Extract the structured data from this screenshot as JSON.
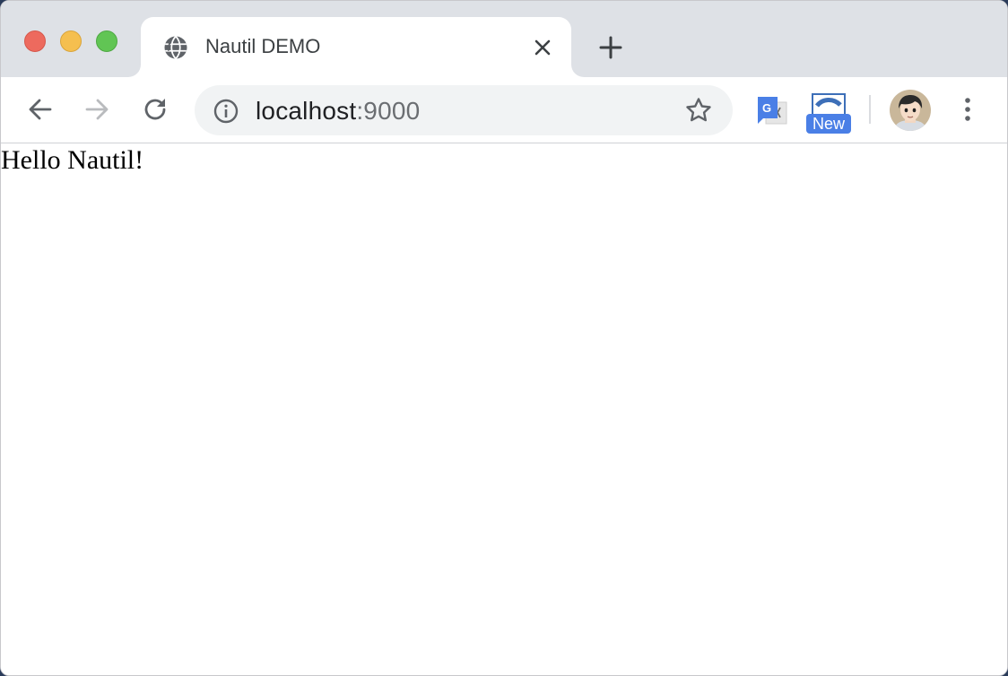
{
  "window": {
    "traffic_lights": {
      "close": "#ed6a5e",
      "minimize": "#f5bf4f",
      "maximize": "#61c554"
    }
  },
  "tab": {
    "title": "Nautil DEMO",
    "favicon": "globe-icon",
    "close_icon": "close-icon"
  },
  "new_tab_icon": "plus-icon",
  "toolbar": {
    "back_icon": "back-arrow-icon",
    "forward_icon": "forward-arrow-icon",
    "reload_icon": "reload-icon"
  },
  "omnibox": {
    "url_host": "localhost",
    "url_port": ":9000",
    "info_icon": "info-icon",
    "bookmark_icon": "star-icon"
  },
  "extensions": {
    "translate_icon": "google-translate-icon",
    "extension_icon": "extension-icon",
    "badge": "New",
    "badge_color": "#4a7fe6"
  },
  "profile_icon": "avatar",
  "menu_icon": "kebab-menu-icon",
  "page": {
    "text": "Hello Nautil!"
  }
}
